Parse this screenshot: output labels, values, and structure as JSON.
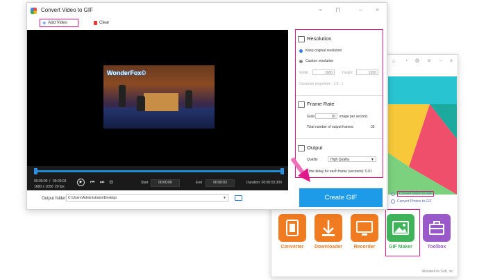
{
  "main_window": {
    "title": "Convert Video to GIF",
    "toolbar": {
      "add_video": "Add Video",
      "clear": "Clear"
    },
    "preview_watermark": "WonderFox©",
    "playback": {
      "time_current": "00:00:00",
      "time_separator": "/",
      "time_total": "00:00:03",
      "resolution_info": "1680 x 1050",
      "fps_info": "20 fps",
      "start_label": "Start",
      "start_value": "00:00:00",
      "end_label": "End",
      "end_value": "00:00:03",
      "duration_text": "Duration: 00:00:03.300"
    },
    "output_folder_label": "Output folder:",
    "output_folder_path": "C:\\Users\\Administrator\\Desktop",
    "create_gif": "Create GIF"
  },
  "settings": {
    "resolution": {
      "title": "Resolution",
      "keep_original": "Keep original resolution",
      "custom": "Custom resolution",
      "width_label": "Width:",
      "width_value": "1680",
      "height_label": "Height:",
      "height_value": "1050",
      "constrain": "Constrain proportion : 1.6 : 1"
    },
    "frame_rate": {
      "title": "Frame Rate",
      "grab_label": "Grab",
      "grab_value": "10",
      "grab_suffix": "image per second.",
      "total_frames": "Total number of output frames:",
      "total_frames_value": "33"
    },
    "output": {
      "title": "Output",
      "quality_label": "Quality",
      "quality_value": "High Quality",
      "delay_text": "Time delay for each frame (seconds): 0.01"
    }
  },
  "launcher": {
    "menu": [
      "Convert Video to GIF",
      "Convert Photos to GIF"
    ],
    "tools": [
      "Converter",
      "Downloader",
      "Recorder",
      "GIF Maker",
      "Toolbox"
    ],
    "copyright": "WonderFox Soft, Inc"
  },
  "colors": {
    "highlight": "#e0188c",
    "accent": "#1e9be8",
    "converter": "#f07b21",
    "gif_maker": "#3fb35a",
    "toolbox": "#9a59c9"
  }
}
